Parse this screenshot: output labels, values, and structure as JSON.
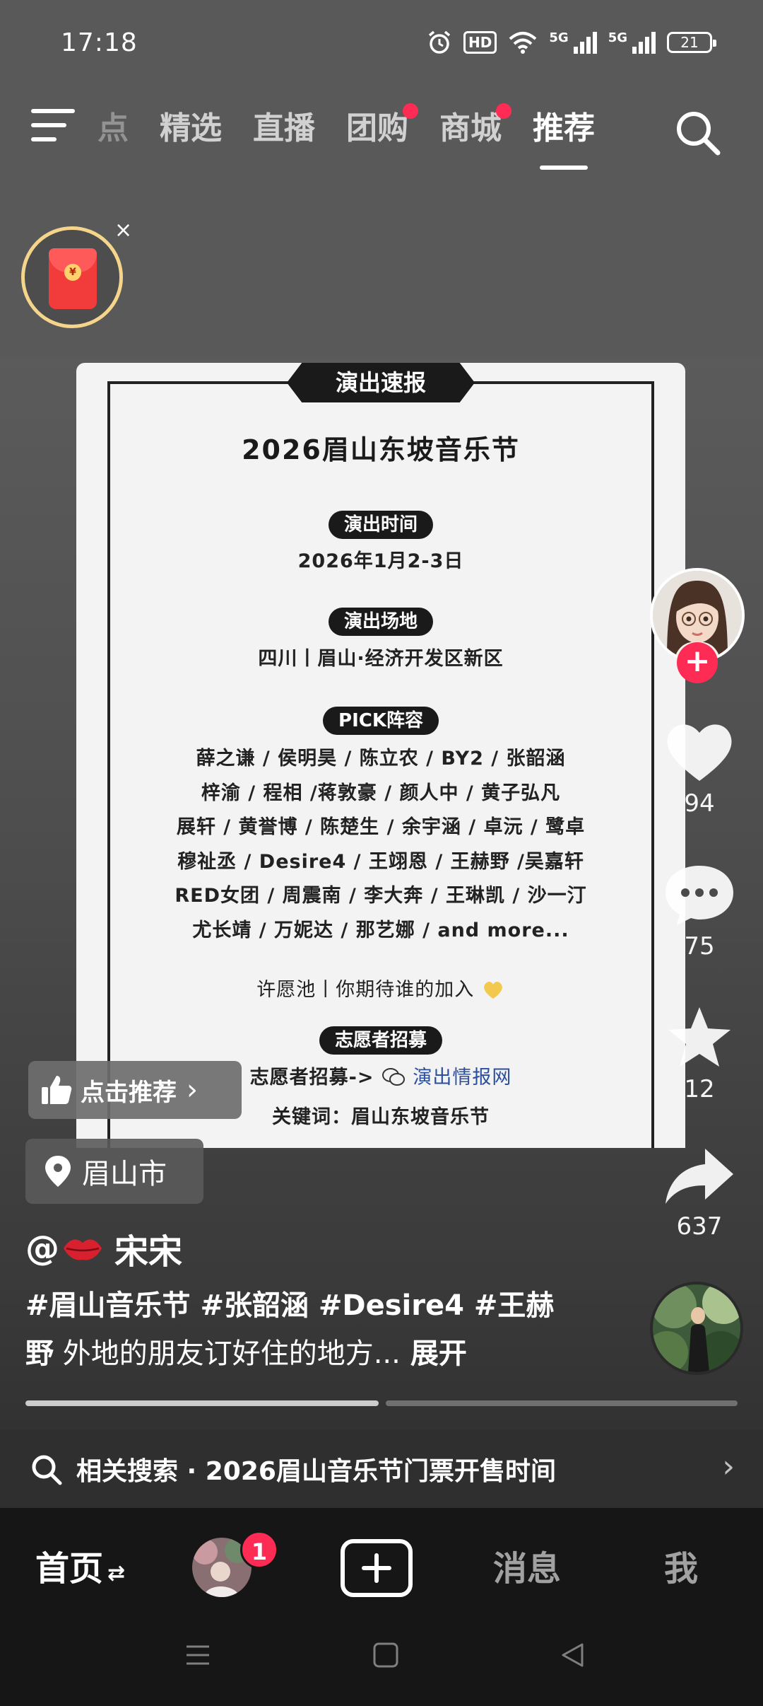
{
  "status_bar": {
    "time": "17:18",
    "hd_label": "HD",
    "network_labels": [
      "5G",
      "5G"
    ],
    "battery": "21",
    "icons": [
      "alarm-icon",
      "wifi-icon",
      "signal-icon",
      "battery-icon"
    ]
  },
  "top_tabs": {
    "items": [
      {
        "label": "点",
        "state": "faded"
      },
      {
        "label": "精选",
        "state": "normal"
      },
      {
        "label": "直播",
        "state": "normal"
      },
      {
        "label": "团购",
        "state": "normal",
        "dot": true
      },
      {
        "label": "商城",
        "state": "normal",
        "dot": true
      },
      {
        "label": "推荐",
        "state": "active"
      }
    ],
    "icons": [
      "menu-icon",
      "search-icon"
    ]
  },
  "red_packet": {
    "coin_label": "¥",
    "close": "×"
  },
  "poster": {
    "banner": "演出速报",
    "title": "2026眉山东坡音乐节",
    "time_label": "演出时间",
    "time_value": "2026年1月2-3日",
    "venue_label": "演出场地",
    "venue_value": "四川丨眉山·经济开发区新区",
    "lineup_label": "PICK阵容",
    "lineup_lines": [
      "薛之谦 / 侯明昊 / 陈立农 / BY2 / 张韶涵",
      "梓渝 / 程相 /蒋敦豪 / 颜人中 / 黄子弘凡",
      "展轩 / 黄誉博 / 陈楚生 / 余宇涵 / 卓沅 / 鹭卓",
      "穆祉丞 / Desire4 / 王翊恩 / 王赫野 /吴嘉轩",
      "RED女团 / 周震南 / 李大奔 / 王琳凯 / 沙一汀",
      "尤长靖 / 万妮达 / 那艺娜 / and more..."
    ],
    "wish_text": "许愿池丨你期待谁的加入",
    "volunteer_label": "志愿者招募",
    "volunteer_prefix": "志愿者招募->",
    "volunteer_account": "演出情报网",
    "keyword_line": "关键词：眉山东坡音乐节"
  },
  "recommend_button": {
    "label": "点击推荐",
    "chevron": "›"
  },
  "location": {
    "label": "眉山市"
  },
  "right_rail": {
    "like_count": "94",
    "comment_count": "75",
    "favorite_count": "12",
    "share_count": "637",
    "follow": "+"
  },
  "author": {
    "name": "@💋 宋宋",
    "handle_prefix": "@",
    "display_name": "宋宋"
  },
  "caption": {
    "tags_line": "#眉山音乐节 #张韶涵 #Desire4 #王赫",
    "rest_bold": "野",
    "rest_text": " 外地的朋友订好住的地方...",
    "more": "展开"
  },
  "progress": {
    "played_fraction": 0.5
  },
  "related_search": {
    "text": "相关搜索 · 2026眉山音乐节门票开售时间"
  },
  "bottom_nav": {
    "home": "首页",
    "home_switch": "⇄",
    "friends_badge": "1",
    "messages": "消息",
    "me": "我"
  },
  "colors": {
    "accent": "#fe2c55",
    "gold_ring": "#f5d58b",
    "nav_bg": "#161616"
  }
}
